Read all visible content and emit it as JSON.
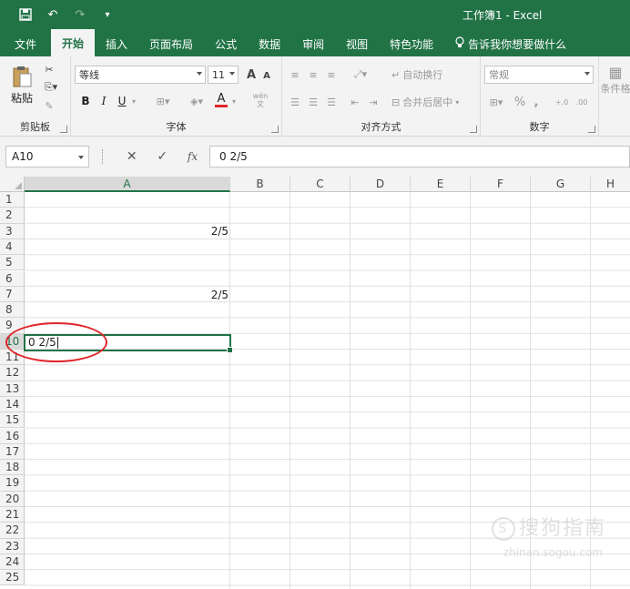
{
  "window": {
    "title": "工作簿1  -  Excel"
  },
  "tabs": [
    {
      "label": "文件"
    },
    {
      "label": "开始"
    },
    {
      "label": "插入"
    },
    {
      "label": "页面布局"
    },
    {
      "label": "公式"
    },
    {
      "label": "数据"
    },
    {
      "label": "审阅"
    },
    {
      "label": "视图"
    },
    {
      "label": "特色功能"
    },
    {
      "label": "告诉我你想要做什么"
    }
  ],
  "ribbon": {
    "clipboard": {
      "paste": "粘贴",
      "group": "剪贴板"
    },
    "font": {
      "name": "等线",
      "size": "11",
      "bold": "B",
      "italic": "I",
      "underline": "U",
      "color_a": "A",
      "wen": "wén\n文",
      "grow": "A",
      "shrink": "A",
      "group": "字体"
    },
    "alignment": {
      "wrap": "自动换行",
      "merge": "合并后居中",
      "group": "对齐方式"
    },
    "number": {
      "format": "常规",
      "percent": "%",
      "comma": ",",
      "group": "数字"
    },
    "styles": {
      "cond": "条件格"
    }
  },
  "formula_bar": {
    "name_box": "A10",
    "fx": "fx",
    "cancel": "✕",
    "enter": "✓",
    "content": "0 2/5"
  },
  "grid": {
    "columns": [
      "A",
      "B",
      "C",
      "D",
      "E",
      "F",
      "G",
      "H"
    ],
    "rows": [
      "1",
      "2",
      "3",
      "4",
      "5",
      "6",
      "7",
      "8",
      "9",
      "10",
      "11",
      "12",
      "13",
      "14",
      "15",
      "16",
      "17",
      "18",
      "19",
      "20",
      "21",
      "22",
      "23",
      "24",
      "25"
    ],
    "cells": {
      "a3": "2/5",
      "a7": "2/5",
      "a10": "0 2/5"
    }
  },
  "watermark": {
    "text": "搜狗指南",
    "url": "zhinan.sogou.com"
  },
  "colors": {
    "accent": "#217346",
    "highlight": "#e0262b"
  }
}
